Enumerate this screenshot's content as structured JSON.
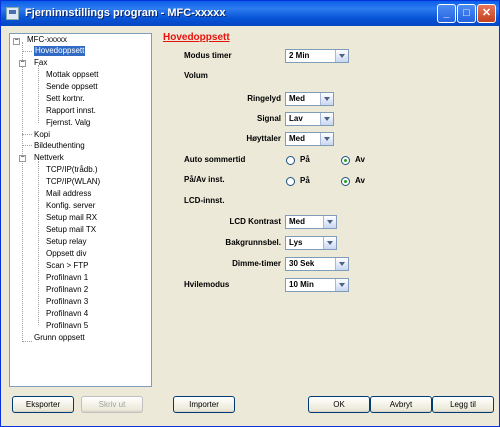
{
  "window": {
    "title": "Fjerninnstillings program - MFC-xxxxx"
  },
  "tree": {
    "items": [
      {
        "label": "MFC-xxxxx"
      },
      {
        "label": "Hovedoppsett"
      },
      {
        "label": "Fax"
      },
      {
        "label": "Mottak oppsett"
      },
      {
        "label": "Sende oppsett"
      },
      {
        "label": "Sett kortnr."
      },
      {
        "label": "Rapport innst."
      },
      {
        "label": "Fjernst. Valg"
      },
      {
        "label": "Kopi"
      },
      {
        "label": "Bildeuthenting"
      },
      {
        "label": "Nettverk"
      },
      {
        "label": "TCP/IP(trådb.)"
      },
      {
        "label": "TCP/IP(WLAN)"
      },
      {
        "label": "Mail address"
      },
      {
        "label": "Konfig. server"
      },
      {
        "label": "Setup mail RX"
      },
      {
        "label": "Setup mail TX"
      },
      {
        "label": "Setup relay"
      },
      {
        "label": "Oppsett  div"
      },
      {
        "label": "Scan > FTP"
      },
      {
        "label": "Profilnavn 1"
      },
      {
        "label": "Profilnavn 2"
      },
      {
        "label": "Profilnavn 3"
      },
      {
        "label": "Profilnavn 4"
      },
      {
        "label": "Profilnavn 5"
      },
      {
        "label": "Grunn oppsett"
      }
    ]
  },
  "section": {
    "title": "Hovedoppsett"
  },
  "settings": {
    "modus_timer": {
      "label": "Modus timer",
      "value": "2 Min"
    },
    "volum": {
      "label": "Volum"
    },
    "ringelyd": {
      "label": "Ringelyd",
      "value": "Med"
    },
    "signal": {
      "label": "Signal",
      "value": "Lav"
    },
    "hoyttaler": {
      "label": "Høyttaler",
      "value": "Med"
    },
    "auto_sommertid": {
      "label": "Auto sommertid",
      "opt_on": "På",
      "opt_off": "Av",
      "selected": "Av"
    },
    "paav_inst": {
      "label": "På/Av inst.",
      "opt_on": "På",
      "opt_off": "Av",
      "selected": "Av"
    },
    "lcd_innst": {
      "label": "LCD-innst."
    },
    "lcd_kontrast": {
      "label": "LCD Kontrast",
      "value": "Med"
    },
    "bakgrunnsbel": {
      "label": "Bakgrunnsbel.",
      "value": "Lys"
    },
    "dimme_timer": {
      "label": "Dimme-timer",
      "value": "30 Sek"
    },
    "hvilemodus": {
      "label": "Hvilemodus",
      "value": "10 Min"
    }
  },
  "buttons": {
    "eksporter": "Eksporter",
    "skriv_ut": "Skriv ut",
    "importer": "Importer",
    "ok": "OK",
    "avbryt": "Avbryt",
    "legg_til": "Legg til"
  }
}
